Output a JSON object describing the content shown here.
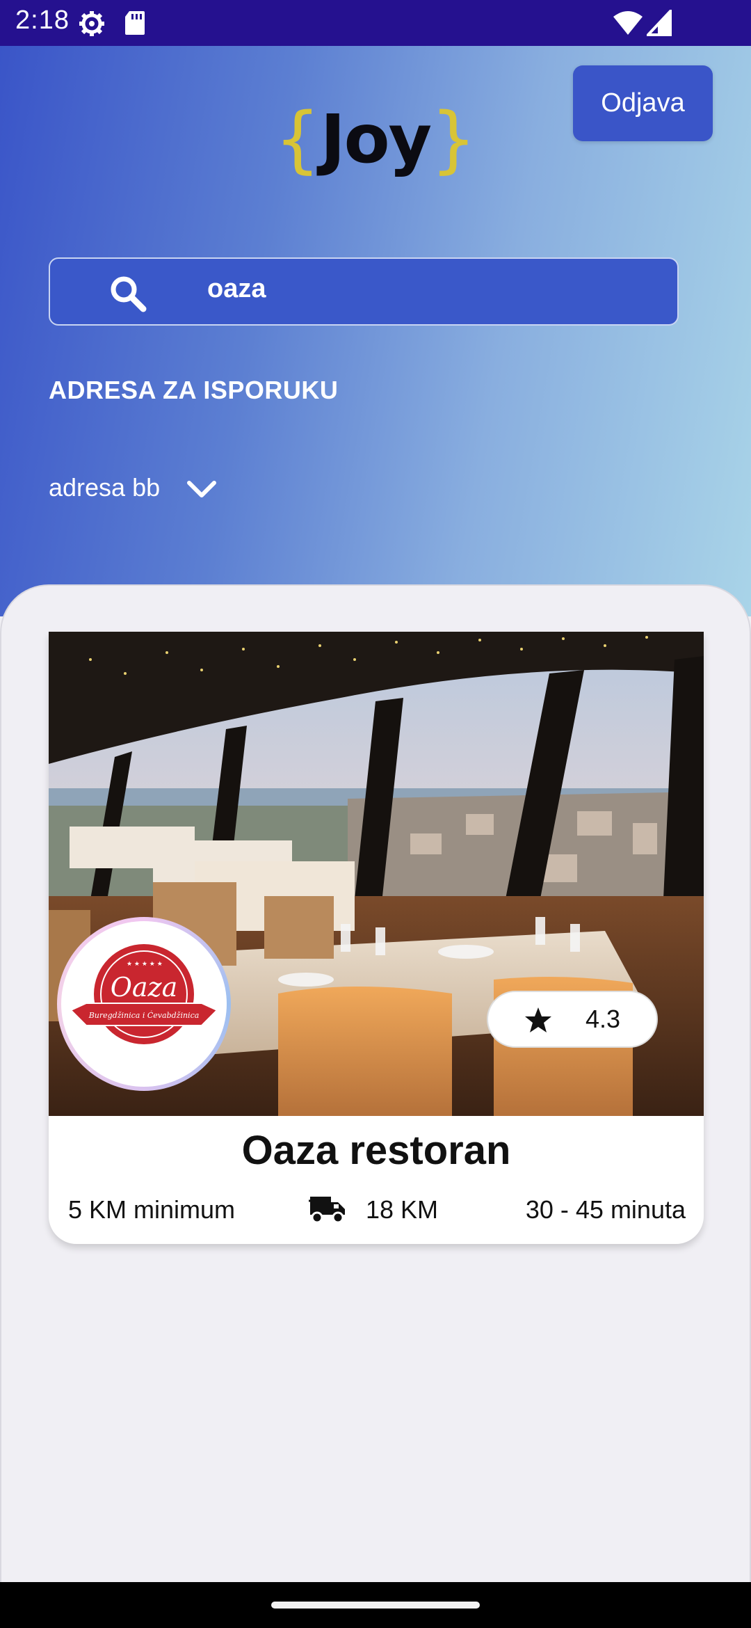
{
  "status_bar": {
    "time": "2:18",
    "icons": [
      "gear-icon",
      "sd-card-icon",
      "wifi-icon",
      "signal-icon"
    ]
  },
  "header": {
    "logo_brace_left": "{",
    "logo_text": "Joy",
    "logo_brace_right": "}",
    "logout_label": "Odjava"
  },
  "search": {
    "value": "oaza",
    "icon": "search-icon"
  },
  "delivery": {
    "heading": "ADRESA ZA ISPORUKU",
    "address": "adresa bb",
    "icon": "chevron-down-icon"
  },
  "restaurant": {
    "name": "Oaza restoran",
    "rating": "4.3",
    "logo_lettering": "Oaza",
    "logo_subtitle": "Buregdžinica i Ćevabdžinica",
    "minimum": "5 KM minimum",
    "delivery_fee": "18 KM",
    "delivery_time": "30 - 45 minuta",
    "icons": [
      "star-icon",
      "truck-icon"
    ]
  },
  "colors": {
    "status_bar": "#25118f",
    "accent_blue": "#3a55c8",
    "logo_yellow": "#d8c436",
    "panel_bg": "#f0eff4",
    "logo_red": "#c9262f"
  }
}
